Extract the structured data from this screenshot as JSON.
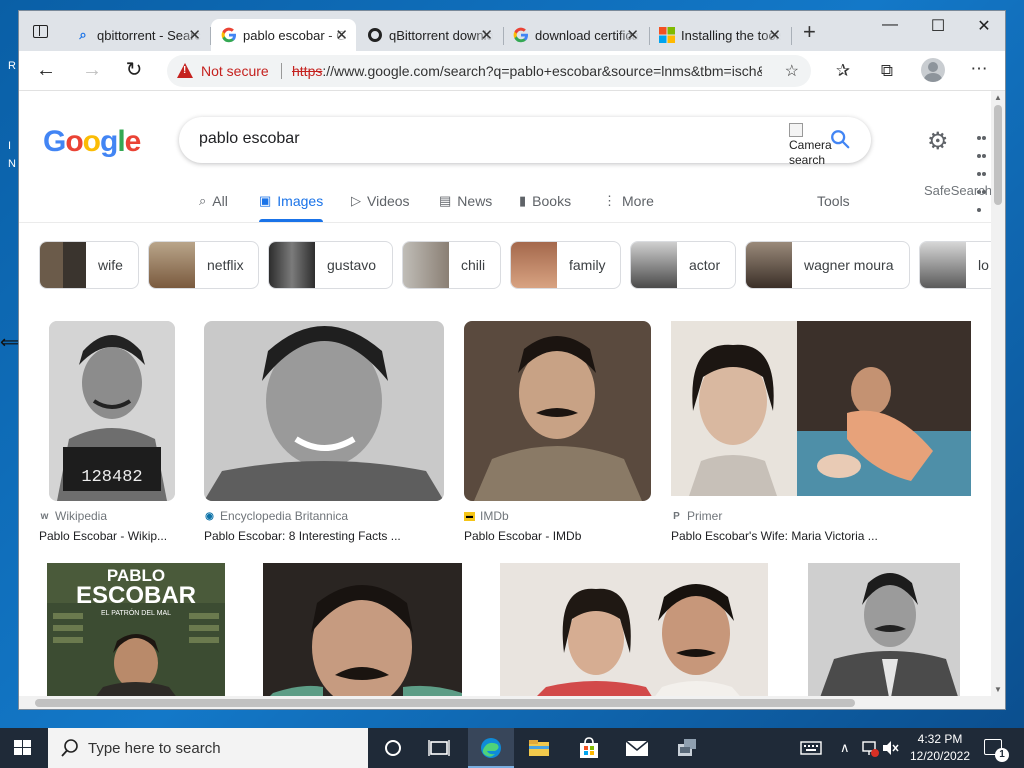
{
  "browser": {
    "tabs": [
      {
        "title": "qbittorrent - Search",
        "fav": "search-icon"
      },
      {
        "title": "pablo escobar - Google Search",
        "fav": "google-icon"
      },
      {
        "title": "qBittorrent download",
        "fav": "qbittorrent-icon"
      },
      {
        "title": "download certificate",
        "fav": "google-icon"
      },
      {
        "title": "Installing the tools",
        "fav": "microsoft-icon"
      }
    ],
    "new_tab": "+",
    "window_controls": {
      "minimize": "—",
      "maximize": "☐",
      "close": "✕"
    },
    "security": "Not secure",
    "url_scheme": "https",
    "url_rest": "://www.google.com/search?q=pablo+escobar&source=lnms&tbm=isch&sa=X"
  },
  "google": {
    "logo_letters": [
      "G",
      "o",
      "o",
      "g",
      "l",
      "e"
    ],
    "logo_colors": [
      "#4285f4",
      "#ea4335",
      "#fbbc05",
      "#4285f4",
      "#34a853",
      "#ea4335"
    ],
    "query": "pablo escobar",
    "camera_alt": "Camera search",
    "safesearch": "SafeSearch",
    "tabs": [
      {
        "label": "All",
        "icon": "⌕"
      },
      {
        "label": "Images",
        "icon": "▣"
      },
      {
        "label": "Videos",
        "icon": "▷"
      },
      {
        "label": "News",
        "icon": "▤"
      },
      {
        "label": "Books",
        "icon": "▮"
      },
      {
        "label": "More",
        "icon": "⋮"
      }
    ],
    "tools": "Tools",
    "chips": [
      "wife",
      "netflix",
      "gustavo",
      "chili",
      "family",
      "actor",
      "wagner moura",
      "lo"
    ],
    "results": [
      {
        "source": "Wikipedia",
        "source_icon": "w",
        "title": "Pablo Escobar - Wikip..."
      },
      {
        "source": "Encyclopedia Britannica",
        "source_icon": "◉",
        "title": "Pablo Escobar: 8 Interesting Facts ..."
      },
      {
        "source": "IMDb",
        "source_icon": "▬",
        "title": "Pablo Escobar - IMDb"
      },
      {
        "source": "Primer",
        "source_icon": "P",
        "title": "Pablo Escobar's Wife: Maria Victoria ..."
      }
    ],
    "poster_text": {
      "line1": "PABLO",
      "line2": "ESCOBAR",
      "line3": "EL PATRÓN DEL MAL"
    },
    "mugshot_number": "128482"
  },
  "taskbar": {
    "search_placeholder": "Type here to search",
    "time": "4:32 PM",
    "date": "12/20/2022",
    "notifications": "1"
  },
  "colors": {
    "accent": "#1a73e8",
    "danger": "#c5221f",
    "taskbar": "#1f2a38"
  }
}
